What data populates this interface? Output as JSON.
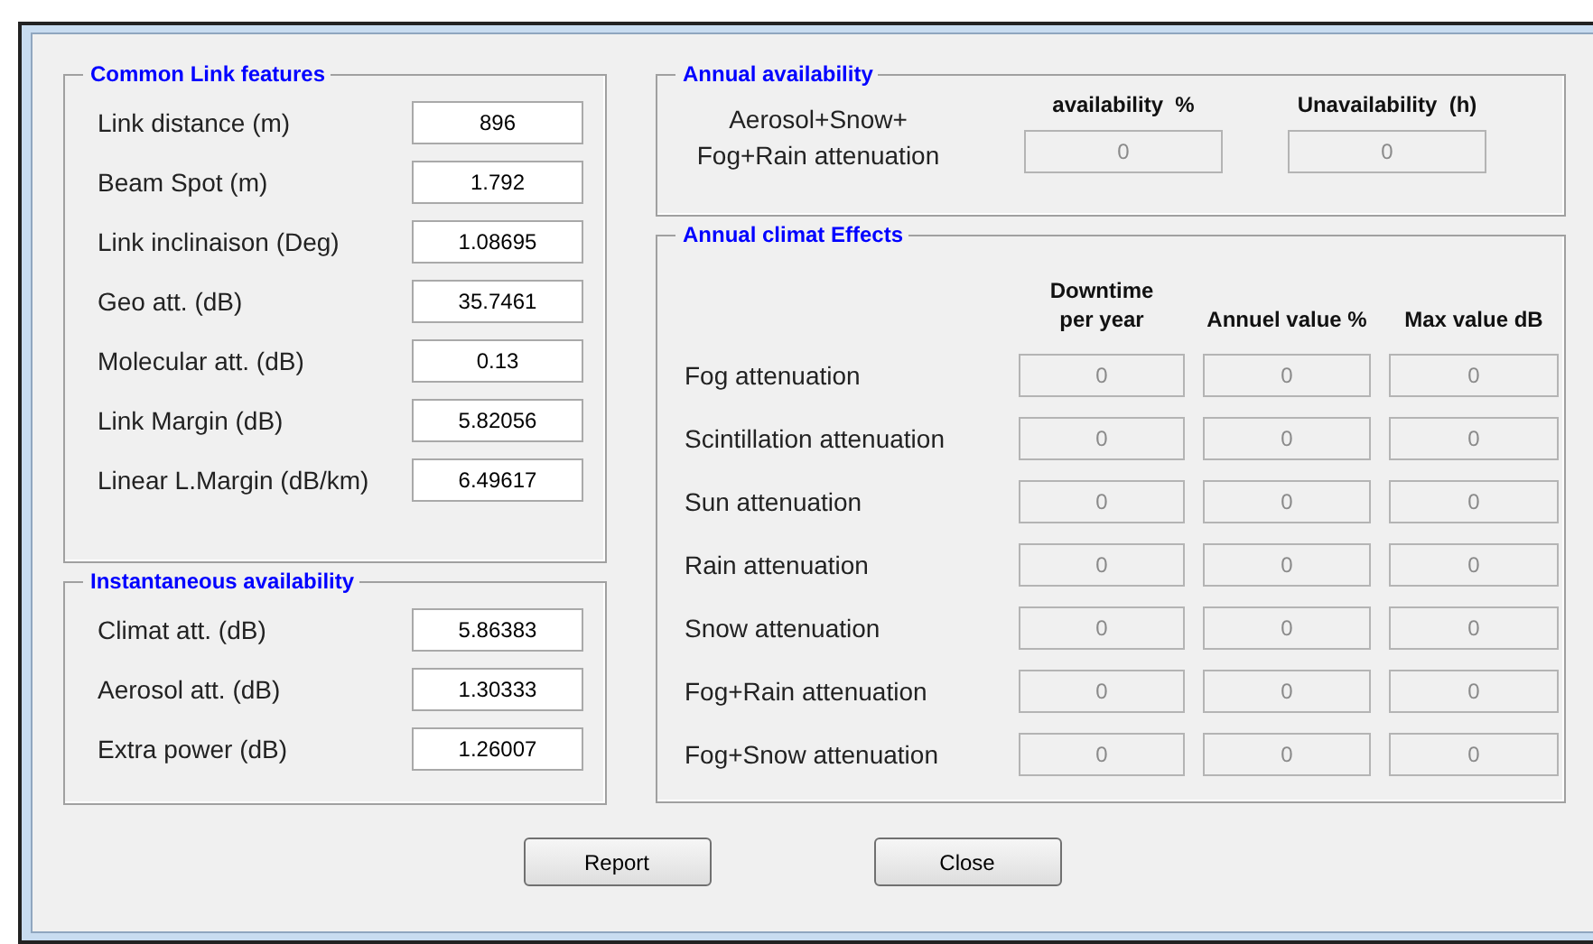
{
  "common_link_features": {
    "title": "Common Link features",
    "rows": [
      {
        "label": "Link distance (m)",
        "value": "896",
        "disabled": false
      },
      {
        "label": "Beam Spot (m)",
        "value": "1.792",
        "disabled": false
      },
      {
        "label": "Link inclinaison (Deg)",
        "value": "1.08695",
        "disabled": false
      },
      {
        "label": "Geo att. (dB)",
        "value": "35.7461",
        "disabled": false
      },
      {
        "label": "Molecular att. (dB)",
        "value": "0.13",
        "disabled": false
      },
      {
        "label": "Link Margin (dB)",
        "value": "5.82056",
        "disabled": false
      },
      {
        "label": "Linear L.Margin (dB/km)",
        "value": "6.49617",
        "disabled": false
      }
    ]
  },
  "instantaneous_availability": {
    "title": "Instantaneous availability",
    "rows": [
      {
        "label": "Climat att. (dB)",
        "value": "5.86383",
        "disabled": false
      },
      {
        "label": "Aerosol att. (dB)",
        "value": "1.30333",
        "disabled": false
      },
      {
        "label": "Extra power (dB)",
        "value": "1.26007",
        "disabled": false
      }
    ]
  },
  "annual_availability": {
    "title": "Annual availability",
    "label": "Aerosol+Snow+\nFog+Rain attenuation",
    "columns": [
      {
        "header": "availability  %",
        "value": "0",
        "disabled": true
      },
      {
        "header": "Unavailability  (h)",
        "value": "0",
        "disabled": true
      }
    ]
  },
  "annual_climat_effects": {
    "title": "Annual climat Effects",
    "columns": [
      "Downtime\nper year",
      "Annuel value %",
      "Max value dB"
    ],
    "rows": [
      {
        "label": "Fog attenuation",
        "cells": [
          {
            "value": "0",
            "disabled": true
          },
          {
            "value": "0",
            "disabled": true
          },
          {
            "value": "0",
            "disabled": true
          }
        ]
      },
      {
        "label": "Scintillation attenuation",
        "cells": [
          {
            "value": "0",
            "disabled": true
          },
          {
            "value": "0",
            "disabled": true
          },
          {
            "value": "0",
            "disabled": true
          }
        ]
      },
      {
        "label": "Sun attenuation",
        "cells": [
          {
            "value": "0",
            "disabled": true
          },
          {
            "value": "0",
            "disabled": true
          },
          {
            "value": "0",
            "disabled": true
          }
        ]
      },
      {
        "label": "Rain attenuation",
        "cells": [
          {
            "value": "0",
            "disabled": true
          },
          {
            "value": "0",
            "disabled": true
          },
          {
            "value": "0",
            "disabled": true
          }
        ]
      },
      {
        "label": "Snow attenuation",
        "cells": [
          {
            "value": "0",
            "disabled": true
          },
          {
            "value": "0",
            "disabled": true
          },
          {
            "value": "0",
            "disabled": true
          }
        ]
      },
      {
        "label": "Fog+Rain attenuation",
        "cells": [
          {
            "value": "0",
            "disabled": true
          },
          {
            "value": "0",
            "disabled": true
          },
          {
            "value": "0",
            "disabled": true
          }
        ]
      },
      {
        "label": "Fog+Snow attenuation",
        "cells": [
          {
            "value": "0",
            "disabled": true
          },
          {
            "value": "0",
            "disabled": true
          },
          {
            "value": "0",
            "disabled": true
          }
        ]
      }
    ]
  },
  "buttons": [
    {
      "label": "Report"
    },
    {
      "label": "Close"
    }
  ]
}
